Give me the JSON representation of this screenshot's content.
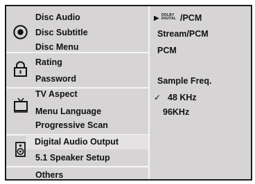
{
  "left_menu": {
    "groups": [
      {
        "icon": "disc-icon",
        "items": [
          "Disc Audio",
          "Disc Subtitle",
          "Disc Menu"
        ]
      },
      {
        "icon": "padlock-icon",
        "items": [
          "Rating",
          "Password"
        ]
      },
      {
        "icon": "tv-icon",
        "items": [
          "TV Aspect",
          "Menu Language",
          "Progressive Scan"
        ]
      },
      {
        "icon": "speaker-icon",
        "items": [
          "Digital Audio Output",
          "5.1 Speaker Setup"
        ]
      },
      {
        "icon": "",
        "items": [
          "Others"
        ]
      }
    ],
    "selected_item": "Digital Audio Output"
  },
  "right_panel": {
    "output_options": [
      {
        "prefix_top": "DOLBY",
        "prefix_bottom": "DIGITAL",
        "label": "/PCM",
        "marker": "▶"
      },
      {
        "label": "Stream/PCM"
      },
      {
        "label": "PCM"
      }
    ],
    "sample_freq_title": "Sample Freq.",
    "sample_freq_options": [
      {
        "label": "48 KHz",
        "checked": true,
        "marker": "✓"
      },
      {
        "label": "96KHz",
        "checked": false
      }
    ]
  }
}
